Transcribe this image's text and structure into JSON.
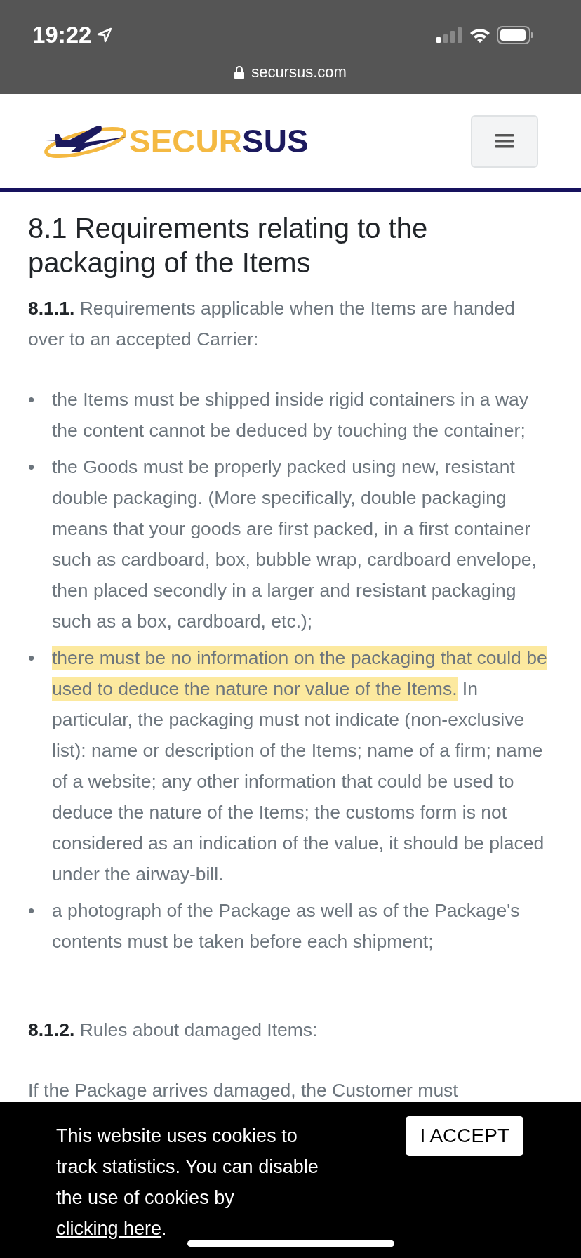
{
  "status_bar": {
    "time": "19:22",
    "url": "secursus.com"
  },
  "header": {
    "logo": {
      "part_1": "SECUR",
      "part_2": "SUS"
    }
  },
  "article": {
    "title": "8.1 Requirements relating to the packaging of the Items",
    "blocks": [
      {
        "kind": "clause",
        "number": "8.1.1.",
        "text": "Requirements applicable when the Items are handed over to an accepted Carrier:"
      },
      {
        "kind": "list",
        "items": [
          {
            "marker": "•",
            "text": "the Items must be shipped inside rigid containers in a way the content cannot be deduced by touching the container;"
          },
          {
            "marker": "•",
            "text": "the Goods must be properly packed using new, resistant double packaging. (More specifically, double packaging means that your goods are first packed, in a first container such as cardboard, box, bubble wrap, cardboard envelope, then placed secondly in a larger and resistant packaging such as a box, cardboard, etc.);"
          },
          {
            "marker": "•",
            "highlight": "there must be no information on the packaging that could be used to deduce the nature nor value of the Items.",
            "text": " In particular, the packaging must not indicate (non-exclusive list): name or description of the Items; name of a firm; name of a website; any other information that could be used to deduce the nature of the Items; the customs form is not considered as an indication of the value, it should be placed under the airway-bill."
          },
          {
            "marker": "•",
            "text": "a photograph of the Package as well as of the Package's contents must be taken before each shipment;"
          }
        ]
      },
      {
        "kind": "clause",
        "number": "8.1.2.",
        "text": "Rules about damaged Items:"
      },
      {
        "kind": "paragraph",
        "text": "If the Package arrives damaged, the Customer must"
      }
    ]
  },
  "cookie_banner": {
    "text": "This website uses cookies to track statistics. You can disable the use of cookies by ",
    "link": "clicking here",
    "end": ".",
    "button": "I ACCEPT"
  }
}
